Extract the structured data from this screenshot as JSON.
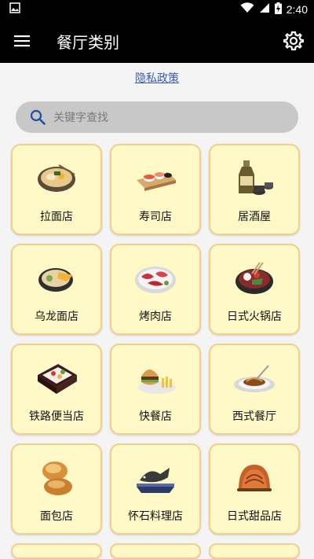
{
  "status": {
    "time": "2:40"
  },
  "appbar": {
    "title": "餐厅类别"
  },
  "privacy_link": "隐私政策",
  "search": {
    "placeholder": "关键字查找"
  },
  "categories": [
    {
      "label": "拉面店",
      "icon": "ramen-bowl-icon"
    },
    {
      "label": "寿司店",
      "icon": "sushi-platter-icon"
    },
    {
      "label": "居酒屋",
      "icon": "sake-bottle-icon"
    },
    {
      "label": "乌龙面店",
      "icon": "udon-bowl-icon"
    },
    {
      "label": "烤肉店",
      "icon": "yakiniku-plate-icon"
    },
    {
      "label": "日式火锅店",
      "icon": "hotpot-icon"
    },
    {
      "label": "铁路便当店",
      "icon": "bento-box-icon"
    },
    {
      "label": "快餐店",
      "icon": "burger-fries-icon"
    },
    {
      "label": "西式餐厅",
      "icon": "pasta-plate-icon"
    },
    {
      "label": "面包店",
      "icon": "bread-icon"
    },
    {
      "label": "怀石料理店",
      "icon": "kaiseki-dish-icon"
    },
    {
      "label": "日式甜品店",
      "icon": "japanese-sweet-icon"
    }
  ]
}
